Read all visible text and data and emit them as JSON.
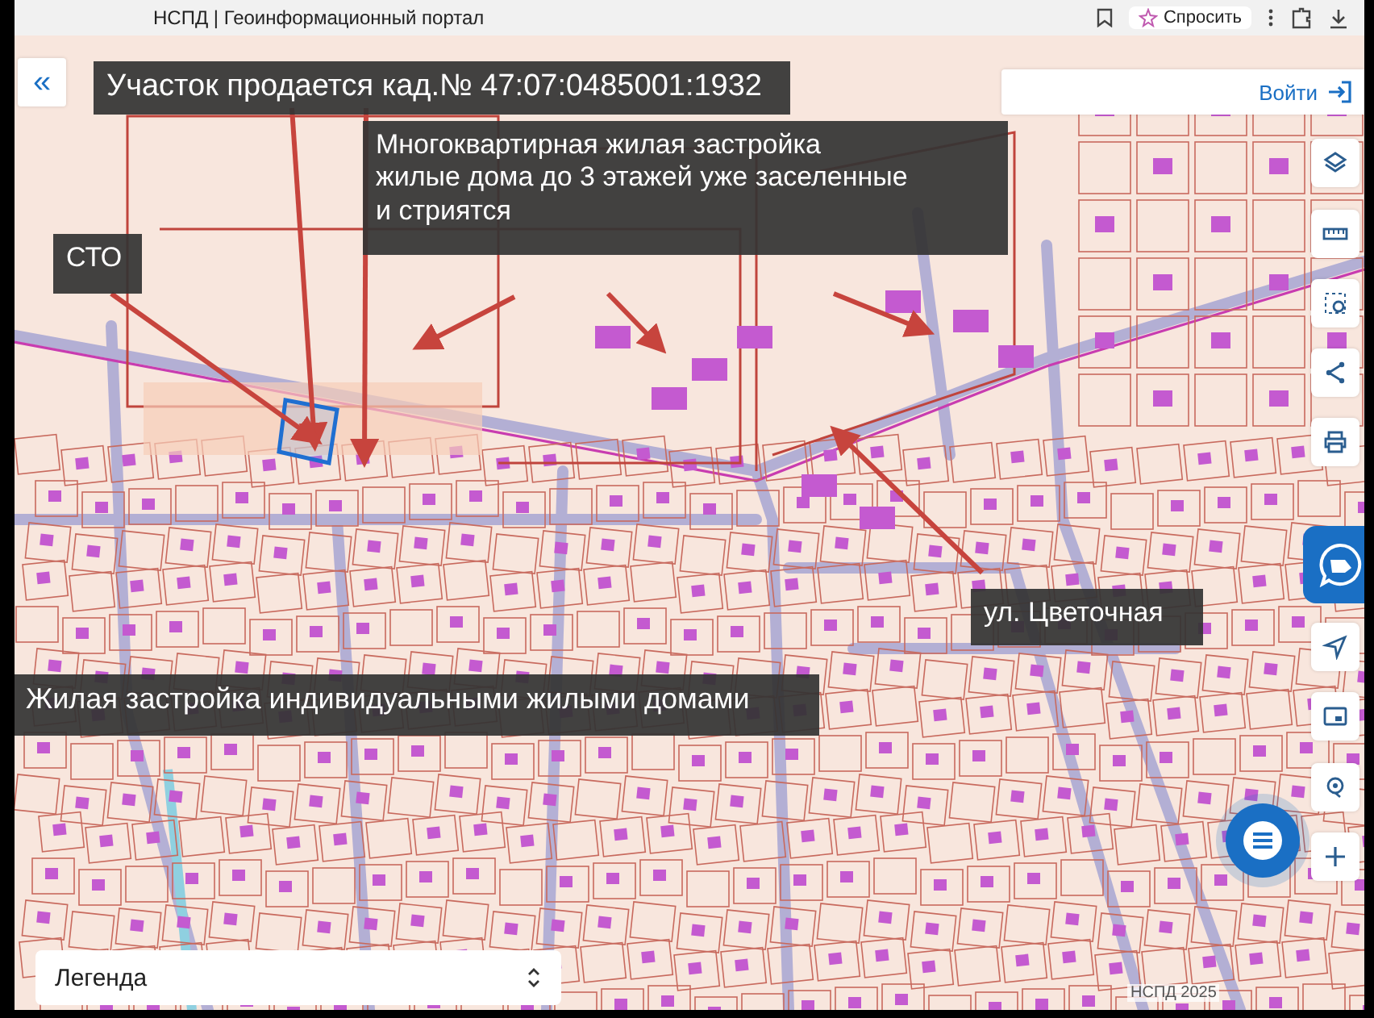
{
  "browser_bar": {
    "title": "НСПД | Геоинформационный портал",
    "ask_button": "Спросить"
  },
  "map": {
    "collapse_button": "«",
    "login_button": "Войти",
    "annotations": [
      {
        "text": "Участок продается кад.№ 47:07:0485001:1932"
      },
      {
        "text": "Многоквартирная жилая застройка\nжилые дома до 3 этажей уже заселенные\nи стриятся"
      },
      {
        "text": "СТО"
      },
      {
        "text": "ул. Цветочная"
      },
      {
        "text": "Жилая застройка индивидуальными жилыми домами"
      }
    ],
    "legend": {
      "label": "Легенда"
    },
    "attribution": "НСПД 2025"
  }
}
